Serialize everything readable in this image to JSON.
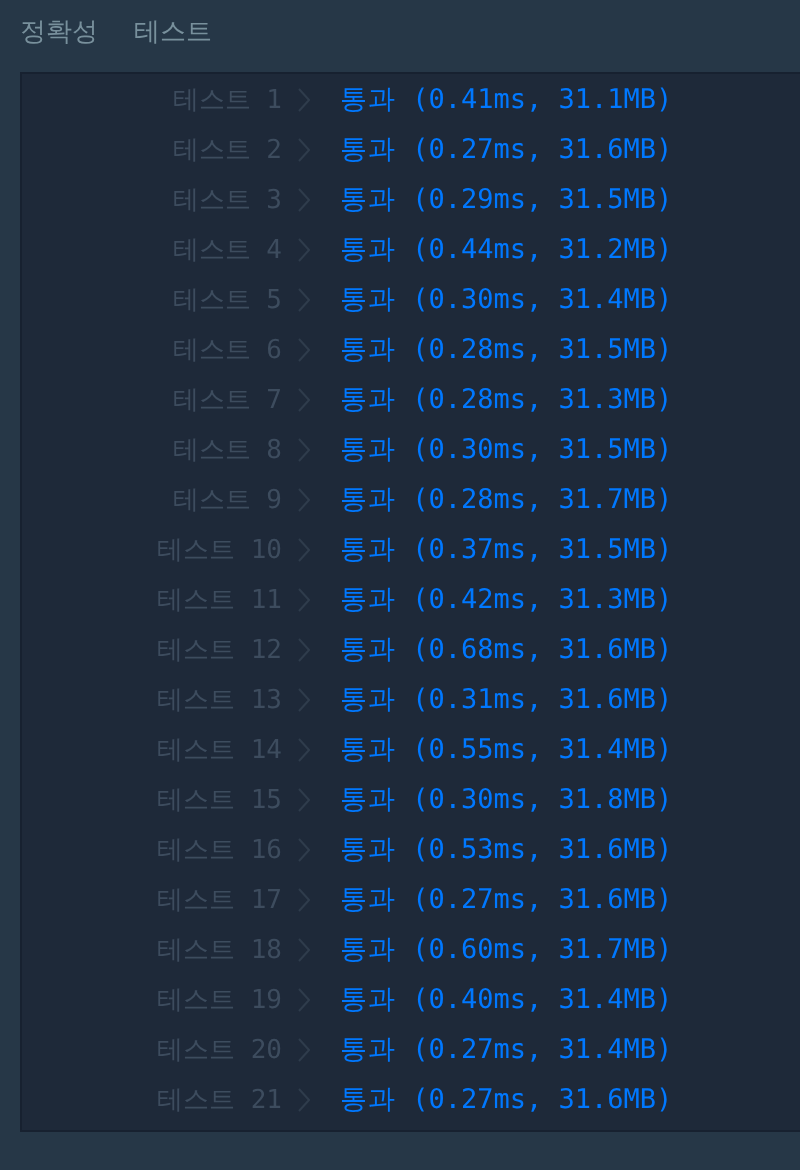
{
  "header": {
    "title": "정확성",
    "subtitle": "테스트"
  },
  "tests": [
    {
      "label": "테스트 1",
      "result": "통과",
      "detail": "(0.41ms, 31.1MB)"
    },
    {
      "label": "테스트 2",
      "result": "통과",
      "detail": "(0.27ms, 31.6MB)"
    },
    {
      "label": "테스트 3",
      "result": "통과",
      "detail": "(0.29ms, 31.5MB)"
    },
    {
      "label": "테스트 4",
      "result": "통과",
      "detail": "(0.44ms, 31.2MB)"
    },
    {
      "label": "테스트 5",
      "result": "통과",
      "detail": "(0.30ms, 31.4MB)"
    },
    {
      "label": "테스트 6",
      "result": "통과",
      "detail": "(0.28ms, 31.5MB)"
    },
    {
      "label": "테스트 7",
      "result": "통과",
      "detail": "(0.28ms, 31.3MB)"
    },
    {
      "label": "테스트 8",
      "result": "통과",
      "detail": "(0.30ms, 31.5MB)"
    },
    {
      "label": "테스트 9",
      "result": "통과",
      "detail": "(0.28ms, 31.7MB)"
    },
    {
      "label": "테스트 10",
      "result": "통과",
      "detail": "(0.37ms, 31.5MB)"
    },
    {
      "label": "테스트 11",
      "result": "통과",
      "detail": "(0.42ms, 31.3MB)"
    },
    {
      "label": "테스트 12",
      "result": "통과",
      "detail": "(0.68ms, 31.6MB)"
    },
    {
      "label": "테스트 13",
      "result": "통과",
      "detail": "(0.31ms, 31.6MB)"
    },
    {
      "label": "테스트 14",
      "result": "통과",
      "detail": "(0.55ms, 31.4MB)"
    },
    {
      "label": "테스트 15",
      "result": "통과",
      "detail": "(0.30ms, 31.8MB)"
    },
    {
      "label": "테스트 16",
      "result": "통과",
      "detail": "(0.53ms, 31.6MB)"
    },
    {
      "label": "테스트 17",
      "result": "통과",
      "detail": "(0.27ms, 31.6MB)"
    },
    {
      "label": "테스트 18",
      "result": "통과",
      "detail": "(0.60ms, 31.7MB)"
    },
    {
      "label": "테스트 19",
      "result": "통과",
      "detail": "(0.40ms, 31.4MB)"
    },
    {
      "label": "테스트 20",
      "result": "통과",
      "detail": "(0.27ms, 31.4MB)"
    },
    {
      "label": "테스트 21",
      "result": "통과",
      "detail": "(0.27ms, 31.6MB)"
    }
  ]
}
